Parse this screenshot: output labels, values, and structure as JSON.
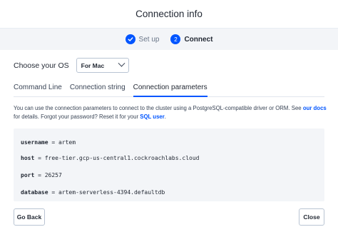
{
  "dialog": {
    "title": "Connection info"
  },
  "stepper": {
    "step1": {
      "icon": "check-icon",
      "label": "Set up",
      "status": "done"
    },
    "step2": {
      "number": "2",
      "label": "Connect",
      "status": "active"
    }
  },
  "os": {
    "label": "Choose your OS",
    "selected": "For Mac"
  },
  "tabs": [
    {
      "label": "Command Line"
    },
    {
      "label": "Connection string"
    },
    {
      "label": "Connection parameters",
      "active": true
    }
  ],
  "description": {
    "text1": "You can use the connection parameters to connect to the cluster using a PostgreSQL-compatible driver or ORM. See ",
    "link1": "our docs",
    "text2": " for details. Forgot your password? Reset it for your ",
    "link2": "SQL user",
    "text3": "."
  },
  "params": [
    {
      "key": "username",
      "value": "artem"
    },
    {
      "key": "host",
      "value": "free-tier.gcp-us-central1.cockroachlabs.cloud"
    },
    {
      "key": "port",
      "value": "26257"
    },
    {
      "key": "database",
      "value": "artem-serverless-4394.defaultdb"
    }
  ],
  "buttons": {
    "back": "Go Back",
    "close": "Close"
  },
  "colors": {
    "accent": "#0055ff",
    "panel": "#f3f5f8",
    "text": "#242a35"
  }
}
